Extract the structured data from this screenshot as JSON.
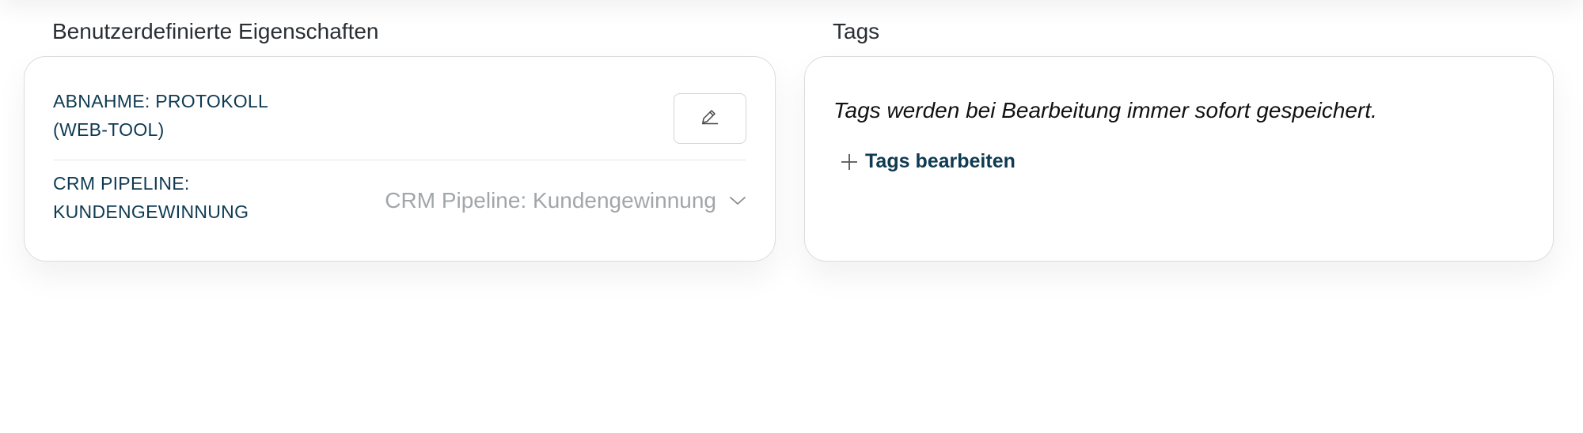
{
  "custom_properties": {
    "title": "Benutzerdefinierte Eigenschaften",
    "rows": [
      {
        "label_line1": "ABNAHME: PROTOKOLL",
        "label_line2": "(WEB-TOOL)",
        "control": "edit-button",
        "icon": "pencil-icon"
      },
      {
        "label_line1": "CRM PIPELINE:",
        "label_line2": "KUNDENGEWINNUNG",
        "control": "select",
        "value": "CRM Pipeline: Kundengewinnung",
        "icon": "chevron-down-icon"
      }
    ]
  },
  "tags": {
    "title": "Tags",
    "note": "Tags werden bei Bearbeitung immer sofort gespeichert.",
    "edit_label": "Tags bearbeiten",
    "edit_icon": "plus-icon"
  },
  "colors": {
    "label": "#0e3a52",
    "muted": "#a2a6a9",
    "border": "#dcdcdc"
  }
}
